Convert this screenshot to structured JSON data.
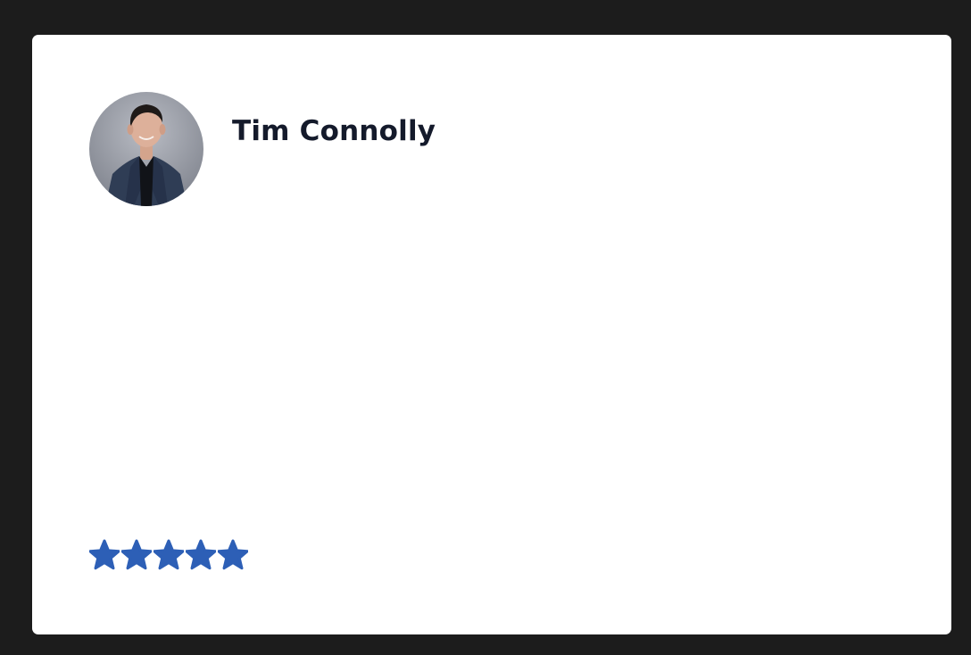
{
  "review": {
    "author_name": "Tim Connolly",
    "avatar_icon": "person-photo-icon",
    "rating": {
      "value": 5,
      "max": 5,
      "icon": "star-icon",
      "color": "#2d5fb6"
    }
  }
}
